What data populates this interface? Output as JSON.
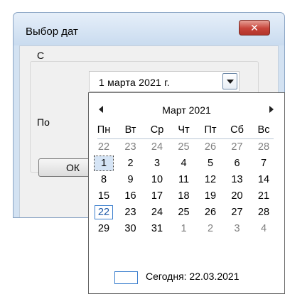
{
  "window": {
    "title": "Выбор дат",
    "close_label": "✕"
  },
  "form": {
    "from_label": "С",
    "to_label": "По",
    "from_value": "1  марта   2021 г.",
    "ok_label": "ОК"
  },
  "calendar": {
    "month_title": "Март 2021",
    "weekdays": [
      "Пн",
      "Вт",
      "Ср",
      "Чт",
      "Пт",
      "Сб",
      "Вс"
    ],
    "weeks": [
      [
        "22",
        "23",
        "24",
        "25",
        "26",
        "27",
        "28"
      ],
      [
        "1",
        "2",
        "3",
        "4",
        "5",
        "6",
        "7"
      ],
      [
        "8",
        "9",
        "10",
        "11",
        "12",
        "13",
        "14"
      ],
      [
        "15",
        "16",
        "17",
        "18",
        "19",
        "20",
        "21"
      ],
      [
        "22",
        "23",
        "24",
        "25",
        "26",
        "27",
        "28"
      ],
      [
        "29",
        "30",
        "31",
        "1",
        "2",
        "3",
        "4"
      ]
    ],
    "today_label": "Сегодня: 22.03.2021"
  }
}
